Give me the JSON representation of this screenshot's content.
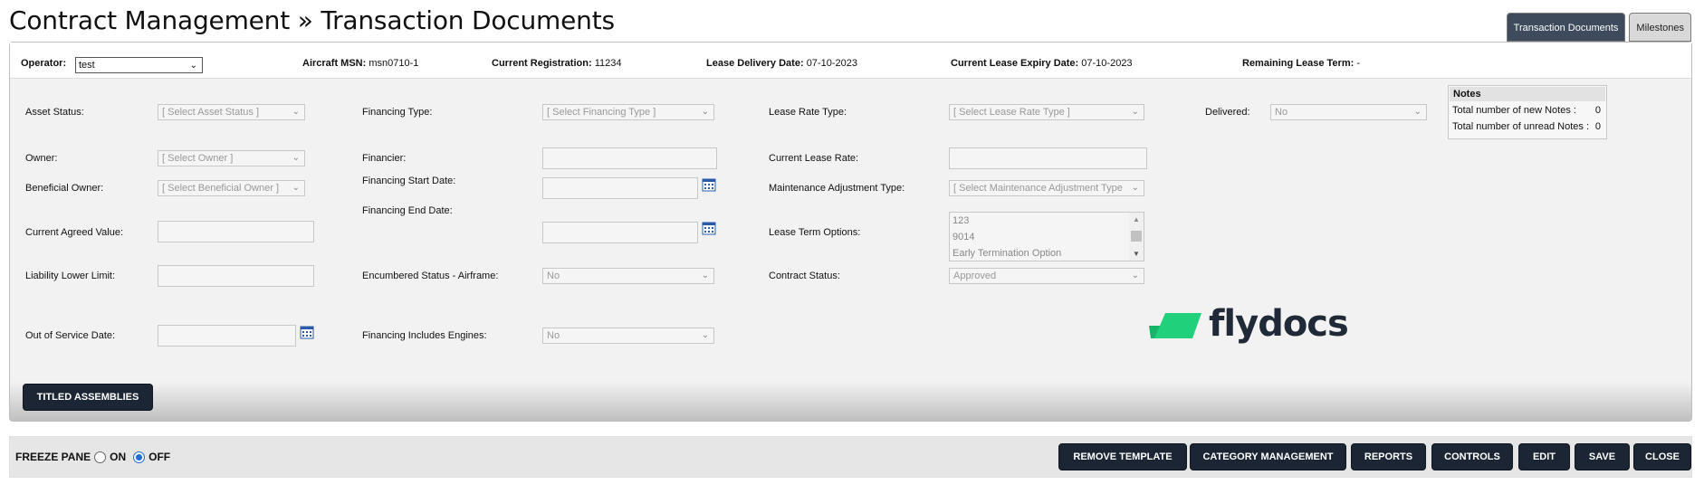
{
  "page": {
    "title": "Contract Management » Transaction Documents"
  },
  "tabs": [
    {
      "label": "Transaction Documents",
      "active": true
    },
    {
      "label": "Milestones",
      "active": false
    }
  ],
  "header": {
    "operator_label": "Operator:",
    "operator_value": "test",
    "msn_label": "Aircraft MSN:",
    "msn_value": "msn0710-1",
    "registration_label": "Current Registration:",
    "registration_value": "11234",
    "delivery_label": "Lease Delivery Date:",
    "delivery_value": "07-10-2023",
    "expiry_label": "Current Lease Expiry Date:",
    "expiry_value": "07-10-2023",
    "remaining_label": "Remaining Lease Term:",
    "remaining_value": "-"
  },
  "fields": {
    "asset_status": {
      "label": "Asset Status:",
      "placeholder": "[ Select Asset Status ]"
    },
    "owner": {
      "label": "Owner:",
      "placeholder": "[ Select Owner ]"
    },
    "beneficial_owner": {
      "label": "Beneficial Owner:",
      "placeholder": "[ Select Beneficial Owner ]"
    },
    "current_agreed_value": {
      "label": "Current Agreed Value:"
    },
    "liability_lower_limit": {
      "label": "Liability Lower Limit:"
    },
    "out_of_service_date": {
      "label": "Out of Service Date:"
    },
    "financing_type": {
      "label": "Financing Type:",
      "placeholder": "[ Select Financing Type ]"
    },
    "financier": {
      "label": "Financier:"
    },
    "financing_start_date": {
      "label": "Financing Start Date:"
    },
    "financing_end_date": {
      "label": "Financing End Date:"
    },
    "encumbered_status": {
      "label": "Encumbered Status - Airframe:",
      "value": "No"
    },
    "financing_includes_engines": {
      "label": "Financing Includes Engines:",
      "value": "No"
    },
    "lease_rate_type": {
      "label": "Lease Rate Type:",
      "placeholder": "[ Select Lease Rate Type ]"
    },
    "current_lease_rate": {
      "label": "Current Lease Rate:"
    },
    "maintenance_adjustment_type": {
      "label": "Maintenance Adjustment Type:",
      "placeholder": "[ Select Maintenance Adjustment Type"
    },
    "lease_term_options": {
      "label": "Lease Term Options:",
      "options": [
        "123",
        "9014",
        "Early Termination Option"
      ]
    },
    "contract_status": {
      "label": "Contract Status:",
      "value": "Approved"
    },
    "delivered": {
      "label": "Delivered:",
      "value": "No"
    }
  },
  "notes": {
    "title": "Notes",
    "new_label": "Total number of new Notes :",
    "new_value": "0",
    "unread_label": "Total number of unread Notes :",
    "unread_value": "0"
  },
  "logo": {
    "text": "flydocs",
    "color": "#21d07a"
  },
  "buttons": {
    "titled_assemblies": "TITLED ASSEMBLIES",
    "remove_template": "REMOVE TEMPLATE",
    "category_management": "CATEGORY MANAGEMENT",
    "reports": "REPORTS",
    "controls": "CONTROLS",
    "edit": "EDIT",
    "save": "SAVE",
    "close": "CLOSE"
  },
  "freeze_pane": {
    "label": "FREEZE PANE",
    "on_label": "ON",
    "off_label": "OFF",
    "selected": "OFF"
  },
  "colors": {
    "accent_dark": "#1b2533",
    "tab_active": "#3d4b5c",
    "radio_selected": "#1f6fd1"
  }
}
